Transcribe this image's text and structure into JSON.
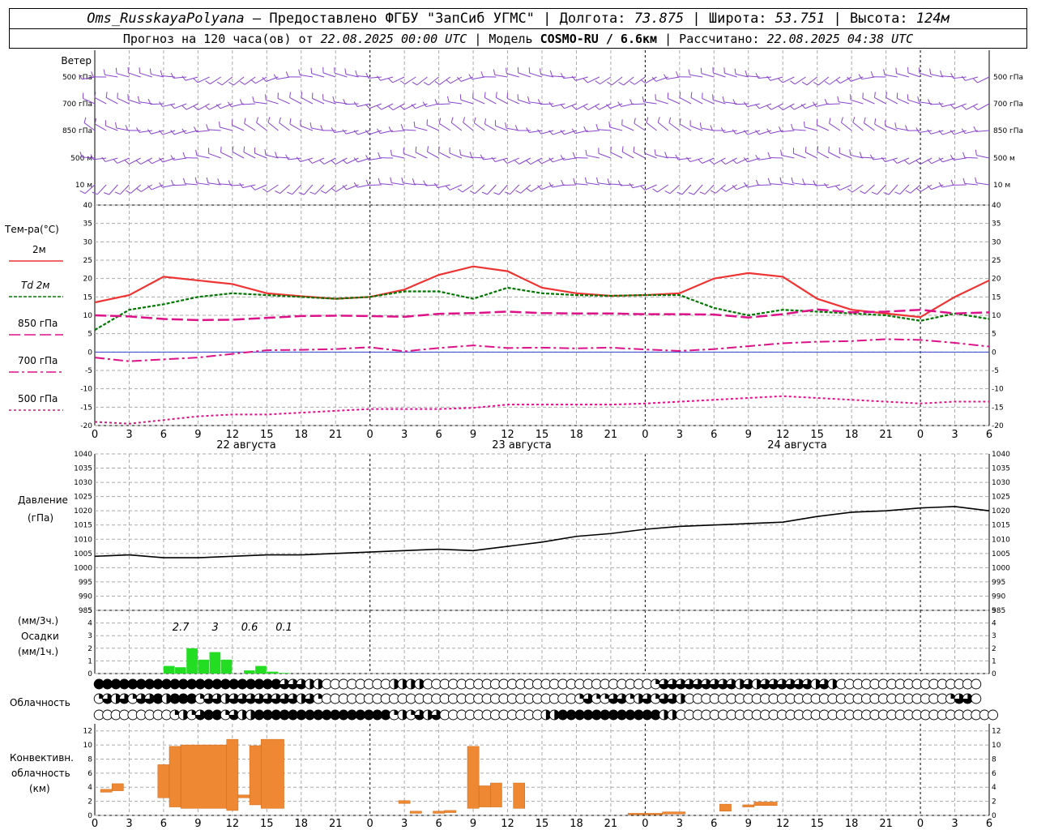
{
  "header": {
    "station": "Oms_RusskayaPolyana",
    "provider": "– Предоставлено ФГБУ \"ЗапСиб УГМС\" | Долгота:",
    "lon": "73.875",
    "lat_label": "| Широта:",
    "lat": "53.751",
    "alt_label": "| Высота:",
    "alt": "124м",
    "forecast_label": "Прогноз на 120 часа(ов) от",
    "forecast_from": "22.08.2025 00:00 UTC",
    "model_label": "| Модель",
    "model": "COSMO-RU / 6.6км",
    "calc_label": "| Рассчитано:",
    "calc": "22.08.2025 04:38 UTC"
  },
  "panel_labels": {
    "wind": "Ветер",
    "temp": "Тем-ра(°C)",
    "pressure_1": "Давление",
    "pressure_2": "(гПа)",
    "precip_1": "(мм/3ч.)",
    "precip_2": "Осадки",
    "precip_3": "(мм/1ч.)",
    "cloud": "Облачность",
    "conv_1": "Конвективн.",
    "conv_2": "облачность",
    "conv_3": "(км)"
  },
  "wind_levels": [
    "500 гПа",
    "700 гПа",
    "850 гПа",
    "500 м",
    "10  м"
  ],
  "legend": [
    {
      "label": "2м",
      "color": "#ee3333"
    },
    {
      "label": "Td  2м",
      "color": "#007700"
    },
    {
      "label": "850 гПа",
      "color": "#dd1188"
    },
    {
      "label": "700 гПа",
      "color": "#dd1188"
    },
    {
      "label": "500 гПа",
      "color": "#dd1188"
    }
  ],
  "x_tick_labels": [
    "0",
    "3",
    "6",
    "9",
    "12",
    "15",
    "18",
    "21",
    "0",
    "3",
    "6",
    "9",
    "12",
    "15",
    "18",
    "21",
    "0",
    "3",
    "6",
    "9",
    "12",
    "15",
    "18",
    "21",
    "0",
    "3",
    "6"
  ],
  "day_labels": [
    "22 августа",
    "23 августа",
    "24 августа"
  ],
  "chart_data": [
    {
      "type": "line",
      "panel": "temperature",
      "x_hours": [
        0,
        3,
        6,
        9,
        12,
        15,
        18,
        21,
        24,
        27,
        30,
        33,
        36,
        39,
        42,
        45,
        48,
        51,
        54,
        57,
        60,
        63,
        66,
        69,
        72,
        75,
        78
      ],
      "ylim": [
        -20,
        40
      ],
      "y_ticks": [
        -20,
        -15,
        -10,
        -5,
        0,
        5,
        10,
        15,
        20,
        25,
        30,
        35,
        40
      ],
      "series": [
        {
          "name": "2м",
          "color": "#ee3333",
          "values": [
            13.5,
            15.5,
            20.5,
            19.5,
            18.5,
            16,
            15.2,
            14.5,
            15,
            17,
            21,
            23.3,
            22,
            17.5,
            16,
            15.3,
            15.5,
            16,
            20,
            21.5,
            20.5,
            14.5,
            11.5,
            10.5,
            9.5,
            15,
            19.5
          ]
        },
        {
          "name": "Td  2м",
          "color": "#007700",
          "values": [
            6,
            11.5,
            13,
            15,
            16,
            15.5,
            15,
            14.5,
            15,
            16.5,
            16.5,
            14.5,
            17.5,
            16,
            15.5,
            15.3,
            15.5,
            15.5,
            12,
            10,
            11.5,
            11,
            10.5,
            10,
            8.5,
            10.5,
            9
          ]
        },
        {
          "name": "850 гПа",
          "color": "#dd1188",
          "values": [
            10,
            9.7,
            9,
            8.7,
            8.8,
            9.3,
            9.8,
            9.9,
            9.8,
            9.6,
            10.4,
            10.6,
            11,
            10.6,
            10.5,
            10.5,
            10.3,
            10.3,
            10.2,
            9.4,
            10.3,
            11.6,
            10.8,
            11,
            11.5,
            10.5,
            10.8
          ]
        },
        {
          "name": "700 гПа",
          "color": "#dd1188",
          "values": [
            -1.5,
            -2.5,
            -2,
            -1.5,
            -0.5,
            0.5,
            0.6,
            0.8,
            1.3,
            0.2,
            1.1,
            1.8,
            1.1,
            1.2,
            1,
            1.2,
            0.7,
            0.3,
            0.8,
            1.6,
            2.4,
            2.8,
            3,
            3.5,
            3.3,
            2.5,
            1.5
          ]
        },
        {
          "name": "500 гПа",
          "color": "#dd1188",
          "values": [
            -19,
            -19.5,
            -18.5,
            -17.5,
            -17,
            -17,
            -16.5,
            -16,
            -15.5,
            -15.5,
            -15.5,
            -15.2,
            -14.3,
            -14.3,
            -14.3,
            -14.3,
            -14,
            -13.5,
            -13,
            -12.5,
            -12,
            -12.5,
            -13,
            -13.5,
            -14,
            -13.5,
            -13.5
          ]
        }
      ]
    },
    {
      "type": "line",
      "panel": "pressure",
      "x_hours": [
        0,
        3,
        6,
        9,
        12,
        15,
        18,
        21,
        24,
        27,
        30,
        33,
        36,
        39,
        42,
        45,
        48,
        51,
        54,
        57,
        60,
        63,
        66,
        69,
        72,
        75,
        78
      ],
      "ylim": [
        985,
        1040
      ],
      "y_ticks": [
        985,
        990,
        995,
        1000,
        1005,
        1010,
        1015,
        1020,
        1025,
        1030,
        1035,
        1040
      ],
      "series": [
        {
          "name": "",
          "color": "#000000",
          "values": [
            1004,
            1004.5,
            1003.5,
            1003.5,
            1004,
            1004.5,
            1004.5,
            1005,
            1005.5,
            1006,
            1006.5,
            1006,
            1007.5,
            1009,
            1011,
            1012,
            1013.5,
            1014.5,
            1015,
            1015.5,
            1016,
            1018,
            1019.5,
            1020,
            1021,
            1021.5,
            1020
          ]
        }
      ]
    },
    {
      "type": "bar",
      "panel": "precipitation",
      "ylim": [
        0,
        5
      ],
      "y_ticks": [
        0,
        1,
        2,
        3,
        4,
        5
      ],
      "hourly_x": [
        6,
        7,
        8,
        9,
        10,
        11,
        13,
        14,
        15,
        16
      ],
      "hourly_values": [
        0.6,
        0.5,
        2,
        1.1,
        1.7,
        1.1,
        0.25,
        0.6,
        0.15,
        0.05
      ],
      "three_hour_labels": [
        {
          "x": 7.5,
          "text": "2.7"
        },
        {
          "x": 10.5,
          "text": "3"
        },
        {
          "x": 13.5,
          "text": "0.6"
        },
        {
          "x": 16.5,
          "text": "0.1"
        }
      ],
      "color": "#22dd22"
    },
    {
      "type": "table",
      "panel": "cloudiness",
      "rows": 3,
      "pattern": [
        "ffffffffffffffffffffffvvvhhoooooooohhhhoooooooooooooooooooooooooooqvvtvtvvtvhvhvvtvtvhvhooooooooooooooooo",
        "qvhtqvtfhfffqvvhvtvvtvtvhvqooooooooooooooooooooooooooooooqvqqvtqhvqvvhoooooooooooooooooooooooooooooooqvvo",
        "oooooooooqhqtffqvhhffffffffffffffffqhqvhtoooooooooooohhffffffffffffhhoooooooooooooooooooooooooooooooooooooo"
      ],
      "legend": {
        "o": "0",
        "q": "1/4",
        "h": "1/2",
        "v": "3/4",
        "t": "3/4",
        "f": "1"
      }
    },
    {
      "type": "bar",
      "panel": "convective_cloud",
      "ylim": [
        0,
        13
      ],
      "y_ticks": [
        0,
        2,
        4,
        6,
        8,
        10,
        12
      ],
      "bars": [
        {
          "x0": 0.5,
          "x1": 1.5,
          "low": 3.3,
          "high": 3.7
        },
        {
          "x0": 1.5,
          "x1": 2.5,
          "low": 3.5,
          "high": 4.5
        },
        {
          "x0": 5.5,
          "x1": 6.5,
          "low": 2.5,
          "high": 7.2
        },
        {
          "x0": 6.5,
          "x1": 7.5,
          "low": 1.2,
          "high": 9.8
        },
        {
          "x0": 7.5,
          "x1": 11.5,
          "low": 1,
          "high": 10
        },
        {
          "x0": 11.5,
          "x1": 12.5,
          "low": 0.7,
          "high": 10.8
        },
        {
          "x0": 12.5,
          "x1": 13.5,
          "low": 2.5,
          "high": 2.9
        },
        {
          "x0": 13.5,
          "x1": 14.5,
          "low": 1.5,
          "high": 9.9
        },
        {
          "x0": 14.5,
          "x1": 16.5,
          "low": 1,
          "high": 10.8
        },
        {
          "x0": 26.5,
          "x1": 27.5,
          "low": 1.7,
          "high": 2.1
        },
        {
          "x0": 27.5,
          "x1": 28.5,
          "low": 0.3,
          "high": 0.6
        },
        {
          "x0": 29.5,
          "x1": 30.5,
          "low": 0.3,
          "high": 0.6
        },
        {
          "x0": 30.5,
          "x1": 31.5,
          "low": 0.4,
          "high": 0.7
        },
        {
          "x0": 32.5,
          "x1": 33.5,
          "low": 1,
          "high": 9.8
        },
        {
          "x0": 33.5,
          "x1": 34.5,
          "low": 1.2,
          "high": 4.2
        },
        {
          "x0": 34.5,
          "x1": 35.5,
          "low": 1.2,
          "high": 4.6
        },
        {
          "x0": 36.5,
          "x1": 37.5,
          "low": 1,
          "high": 4.6
        },
        {
          "x0": 46.5,
          "x1": 49.5,
          "low": 0.1,
          "high": 0.3
        },
        {
          "x0": 49.5,
          "x1": 51.5,
          "low": 0.2,
          "high": 0.5
        },
        {
          "x0": 54.5,
          "x1": 55.5,
          "low": 0.6,
          "high": 1.6
        },
        {
          "x0": 56.5,
          "x1": 57.5,
          "low": 1.2,
          "high": 1.5
        },
        {
          "x0": 57.5,
          "x1": 59.5,
          "low": 1.4,
          "high": 1.9
        }
      ],
      "color": "#ee8833"
    },
    {
      "type": "scatter",
      "panel": "wind",
      "levels": [
        "500 гПа",
        "700 гПа",
        "850 гПа",
        "500 м",
        "10  м"
      ],
      "directions_deg": [
        260,
        270,
        280,
        270,
        250
      ],
      "speeds_kt": [
        25,
        20,
        15,
        12,
        8
      ],
      "color": "#8844cc"
    }
  ]
}
